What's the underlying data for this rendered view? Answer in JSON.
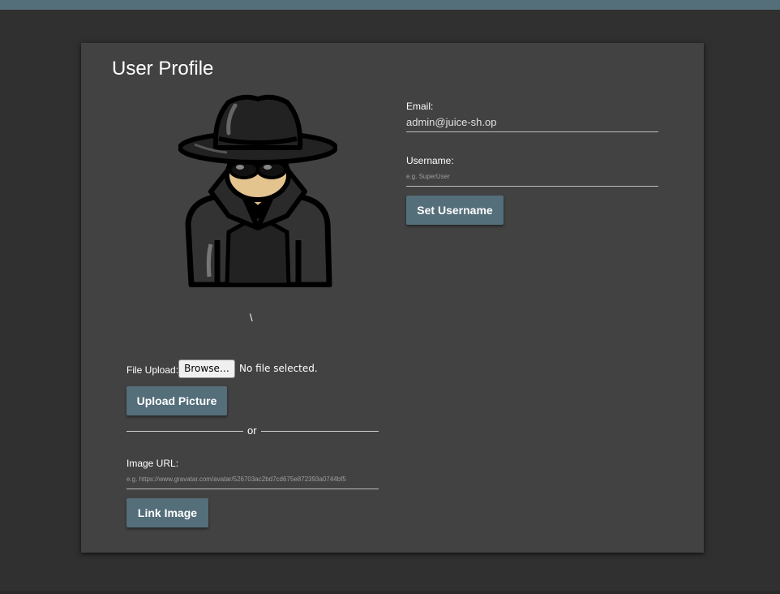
{
  "profile": {
    "title": "User Profile",
    "avatar_icon": "spy-avatar-icon",
    "username_display": "\\"
  },
  "email": {
    "label": "Email:",
    "value": "admin@juice-sh.op"
  },
  "username": {
    "label": "Username:",
    "placeholder": "e.g. SuperUser",
    "button": "Set Username"
  },
  "upload": {
    "label": "File Upload:",
    "browse": "Browse…",
    "status": "No file selected.",
    "button": "Upload Picture"
  },
  "divider": {
    "text": "or"
  },
  "image_url": {
    "label": "Image URL:",
    "placeholder": "e.g. https://www.gravatar.com/avatar/526703ac2bd7cd675e872393a0744bf5",
    "button": "Link Image"
  },
  "colors": {
    "background": "#303030",
    "card": "#424242",
    "primary": "#546e7a"
  }
}
